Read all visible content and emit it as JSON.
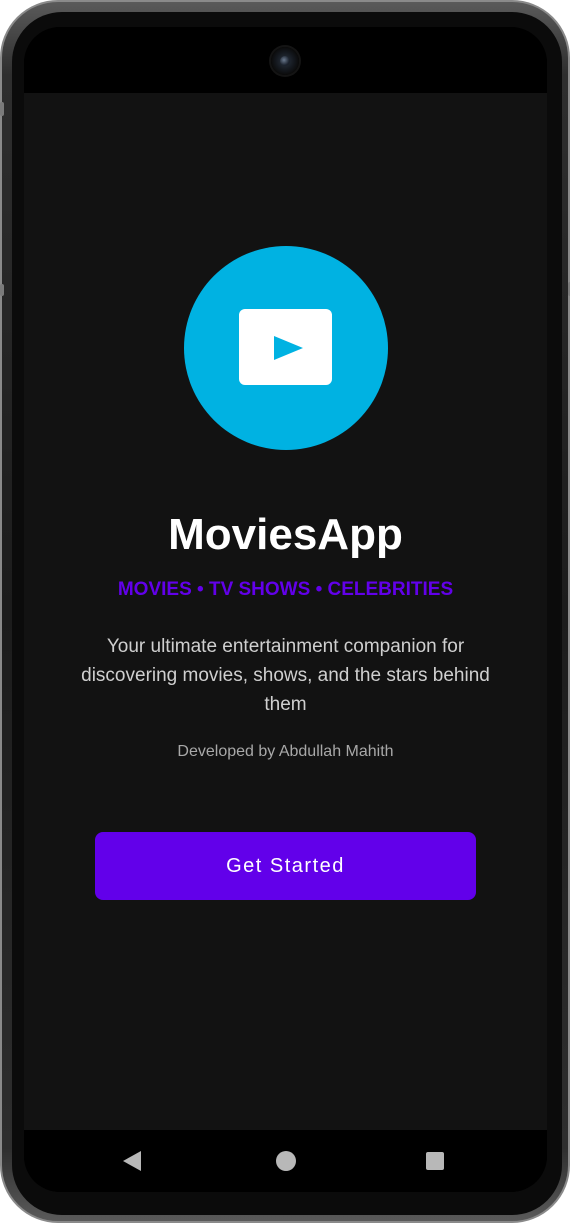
{
  "app": {
    "title": "MoviesApp",
    "tagline": "MOVIES • TV SHOWS • CELEBRITIES",
    "description": "Your ultimate entertainment companion for discovering movies, shows, and the stars behind them",
    "credit": "Developed by Abdullah Mahith"
  },
  "buttons": {
    "get_started_label": "Get Started"
  },
  "icons": {
    "logo": "play-icon",
    "nav_back": "back-triangle-icon",
    "nav_home": "home-circle-icon",
    "nav_recents": "recents-square-icon",
    "camera": "front-camera"
  },
  "colors": {
    "background": "#121212",
    "accent": "#6200ea",
    "logo_circle": "#00b2e2",
    "title_text": "#ffffff",
    "body_text": "#cfcfcf",
    "credit_text": "#a8a8a8"
  }
}
